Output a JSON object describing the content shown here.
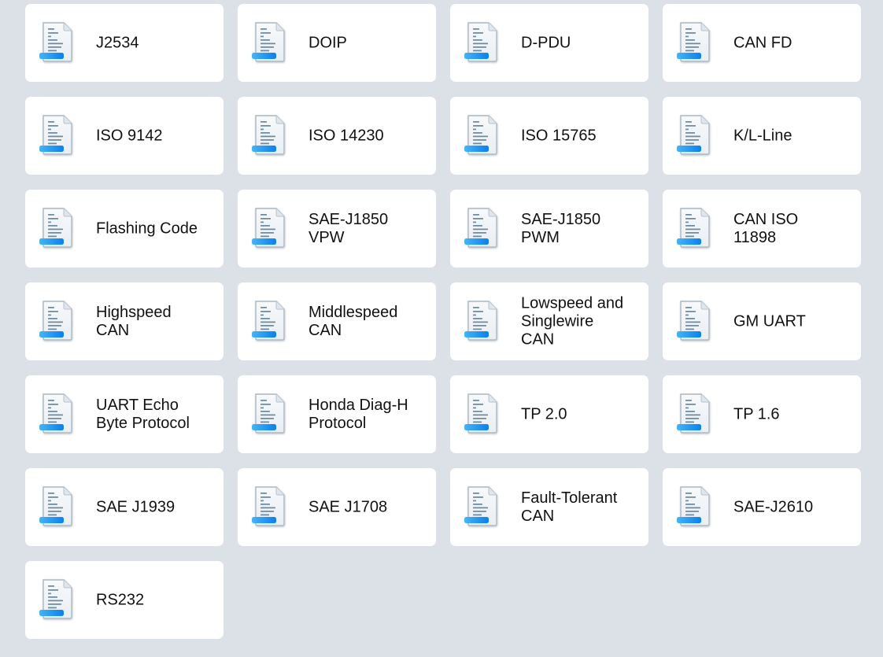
{
  "colors": {
    "background": "#dbe1e7",
    "card": "#ffffff",
    "text": "#111111",
    "icon_accent_start": "#45b4f7",
    "icon_accent_end": "#0a80ee",
    "icon_lines": "#6a8ba3",
    "icon_border": "#a9b7c4"
  },
  "protocols": [
    {
      "icon": "document-icon",
      "lines": [
        "J2534"
      ]
    },
    {
      "icon": "document-icon",
      "lines": [
        "DOIP"
      ]
    },
    {
      "icon": "document-icon",
      "lines": [
        "D-PDU"
      ]
    },
    {
      "icon": "document-icon",
      "lines": [
        "CAN FD"
      ]
    },
    {
      "icon": "document-icon",
      "lines": [
        "ISO 9142"
      ]
    },
    {
      "icon": "document-icon",
      "lines": [
        "ISO 14230"
      ]
    },
    {
      "icon": "document-icon",
      "lines": [
        "ISO 15765"
      ]
    },
    {
      "icon": "document-icon",
      "lines": [
        "K/L-Line"
      ]
    },
    {
      "icon": "document-icon",
      "lines": [
        "Flashing Code"
      ]
    },
    {
      "icon": "document-icon",
      "lines": [
        "SAE-J1850",
        "VPW"
      ]
    },
    {
      "icon": "document-icon",
      "lines": [
        "SAE-J1850",
        "PWM"
      ]
    },
    {
      "icon": "document-icon",
      "lines": [
        "CAN ISO",
        "11898"
      ]
    },
    {
      "icon": "document-icon",
      "lines": [
        "Highspeed",
        "CAN"
      ]
    },
    {
      "icon": "document-icon",
      "lines": [
        "Middlespeed",
        "CAN"
      ]
    },
    {
      "icon": "document-icon",
      "lines": [
        "Lowspeed and",
        "Singlewire",
        "CAN"
      ]
    },
    {
      "icon": "document-icon",
      "lines": [
        "GM UART"
      ]
    },
    {
      "icon": "document-icon",
      "lines": [
        "UART Echo",
        "Byte Protocol"
      ]
    },
    {
      "icon": "document-icon",
      "lines": [
        "Honda Diag-H",
        "Protocol"
      ]
    },
    {
      "icon": "document-icon",
      "lines": [
        "TP 2.0"
      ]
    },
    {
      "icon": "document-icon",
      "lines": [
        "TP 1.6"
      ]
    },
    {
      "icon": "document-icon",
      "lines": [
        "SAE J1939"
      ]
    },
    {
      "icon": "document-icon",
      "lines": [
        "SAE J1708"
      ]
    },
    {
      "icon": "document-icon",
      "lines": [
        "Fault-Tolerant",
        "CAN"
      ]
    },
    {
      "icon": "document-icon",
      "lines": [
        "SAE-J2610"
      ]
    },
    {
      "icon": "document-icon",
      "lines": [
        "RS232"
      ]
    }
  ]
}
